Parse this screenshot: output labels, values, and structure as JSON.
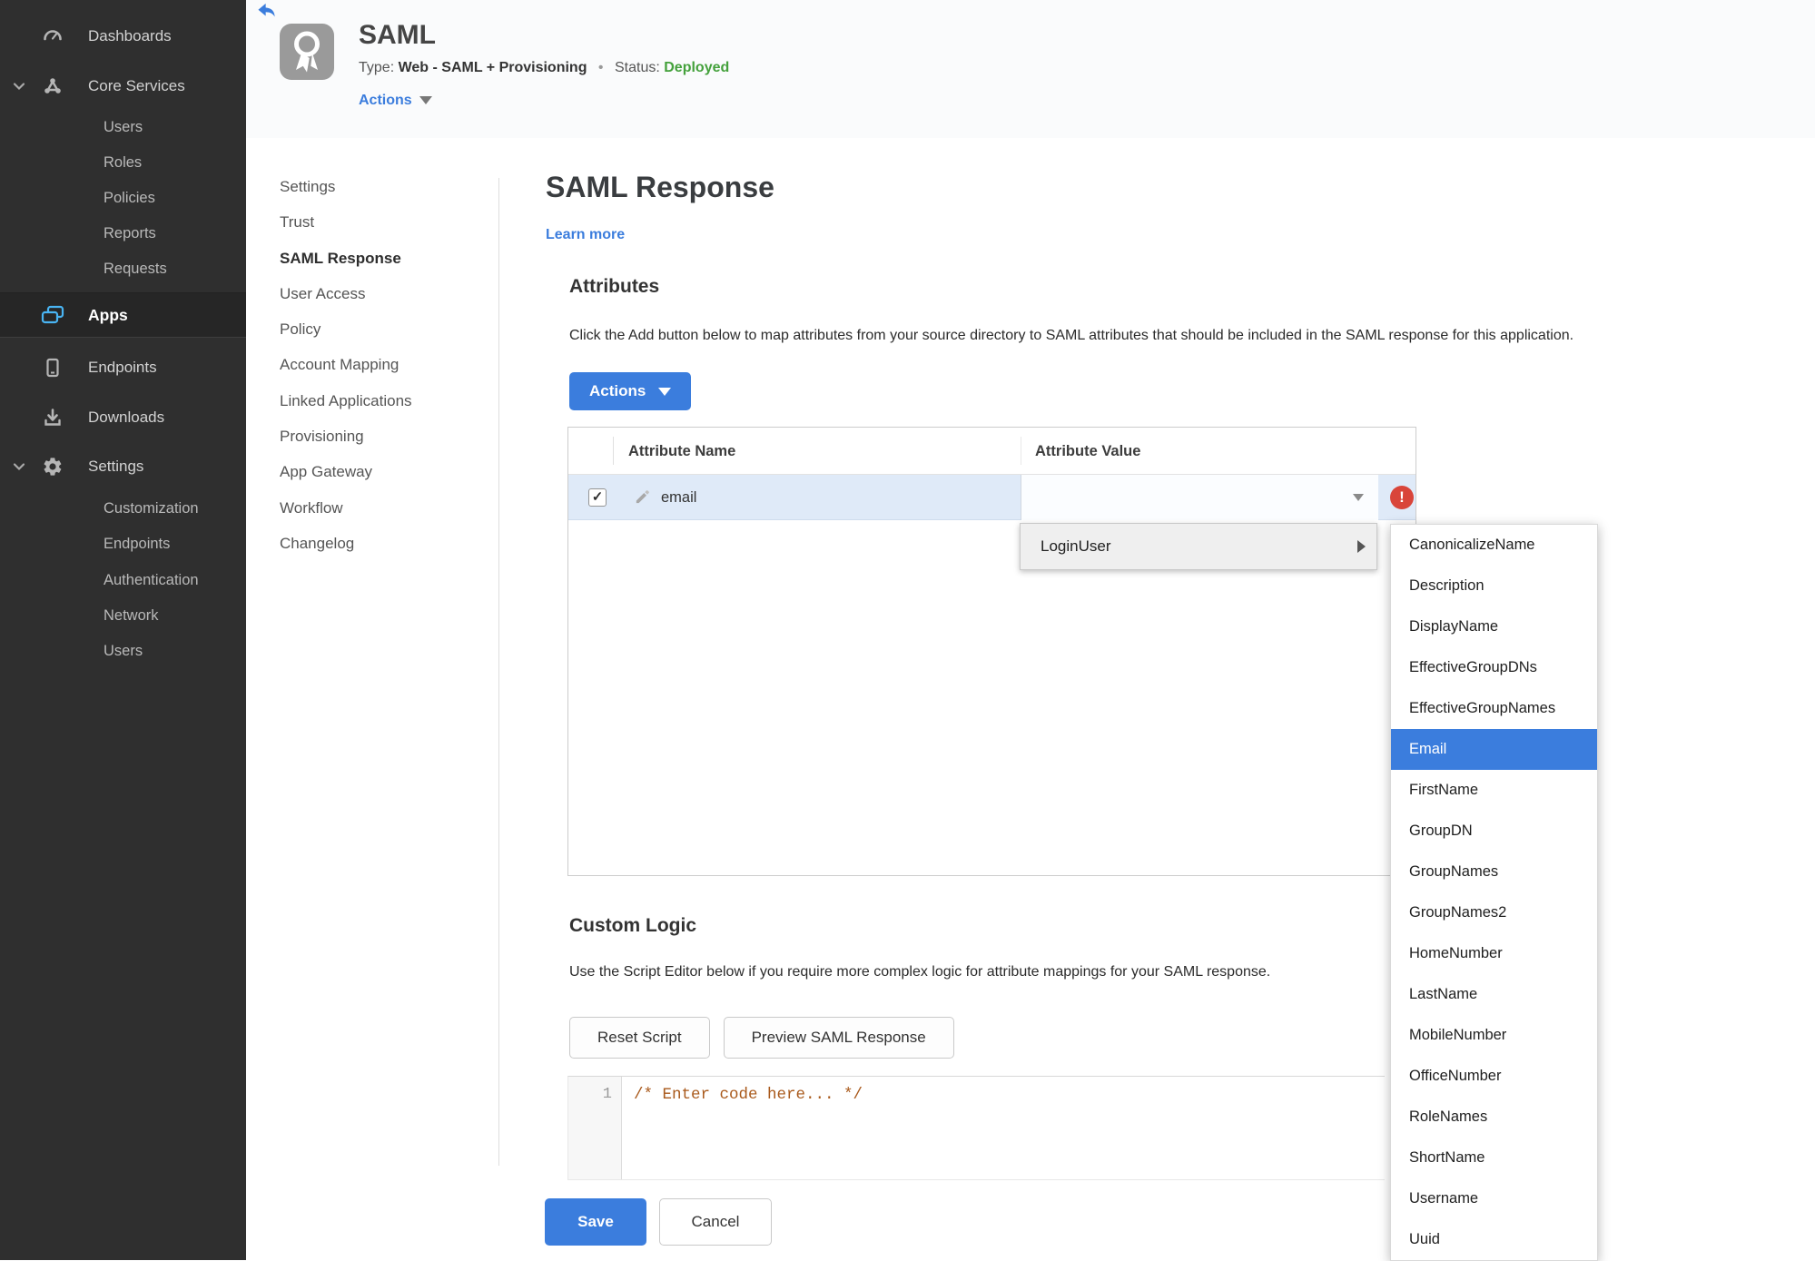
{
  "colors": {
    "accent": "#3b7ddd",
    "green": "#44a13c",
    "error": "#d9453a",
    "rowblue": "#dfeaf8",
    "code": "#a9591b",
    "sidebar_bg": "#2f2f2f"
  },
  "icons": {
    "checkmark": "✓",
    "exclamation": "!"
  },
  "sidebar": {
    "items": [
      {
        "label": "Dashboards"
      },
      {
        "label": "Core Services",
        "expanded": true
      },
      {
        "label": "Users"
      },
      {
        "label": "Roles"
      },
      {
        "label": "Policies"
      },
      {
        "label": "Reports"
      },
      {
        "label": "Requests"
      },
      {
        "label": "Apps",
        "active": true
      },
      {
        "label": "Endpoints"
      },
      {
        "label": "Downloads"
      },
      {
        "label": "Settings",
        "expanded": true
      },
      {
        "label": "Customization"
      },
      {
        "label": "Endpoints"
      },
      {
        "label": "Authentication"
      },
      {
        "label": "Network"
      },
      {
        "label": "Users"
      }
    ]
  },
  "header": {
    "title": "SAML",
    "type_label": "Type:",
    "type_value": "Web - SAML + Provisioning",
    "separator": "•",
    "status_label": "Status:",
    "status_value": "Deployed",
    "actions_label": "Actions"
  },
  "subnav": {
    "items": [
      {
        "label": "Settings"
      },
      {
        "label": "Trust"
      },
      {
        "label": "SAML Response",
        "active": true
      },
      {
        "label": "User Access"
      },
      {
        "label": "Policy"
      },
      {
        "label": "Account Mapping"
      },
      {
        "label": "Linked Applications"
      },
      {
        "label": "Provisioning"
      },
      {
        "label": "App Gateway"
      },
      {
        "label": "Workflow"
      },
      {
        "label": "Changelog"
      }
    ]
  },
  "main": {
    "title": "SAML Response",
    "learn_more": "Learn more",
    "attributes": {
      "heading": "Attributes",
      "description": "Click the Add button below to map attributes from your source directory to SAML attributes that should be included in the SAML response for this application.",
      "actions_button": "Actions",
      "table": {
        "columns": {
          "name": "Attribute Name",
          "value": "Attribute Value"
        },
        "row": {
          "name": "email",
          "value": "",
          "checked": true,
          "error": true
        }
      }
    },
    "dropdown": {
      "parent": "LoginUser",
      "selected": "Email",
      "items": [
        "CanonicalizeName",
        "Description",
        "DisplayName",
        "EffectiveGroupDNs",
        "EffectiveGroupNames",
        "Email",
        "FirstName",
        "GroupDN",
        "GroupNames",
        "GroupNames2",
        "HomeNumber",
        "LastName",
        "MobileNumber",
        "OfficeNumber",
        "RoleNames",
        "ShortName",
        "Username",
        "Uuid"
      ]
    },
    "custom_logic": {
      "heading": "Custom Logic",
      "description": "Use the Script Editor below if you require more complex logic for attribute mappings for your SAML response.",
      "reset_button": "Reset Script",
      "preview_button": "Preview SAML Response",
      "editor": {
        "line_number": "1",
        "code": "/* Enter code here... */"
      }
    },
    "footer": {
      "save": "Save",
      "cancel": "Cancel"
    }
  }
}
